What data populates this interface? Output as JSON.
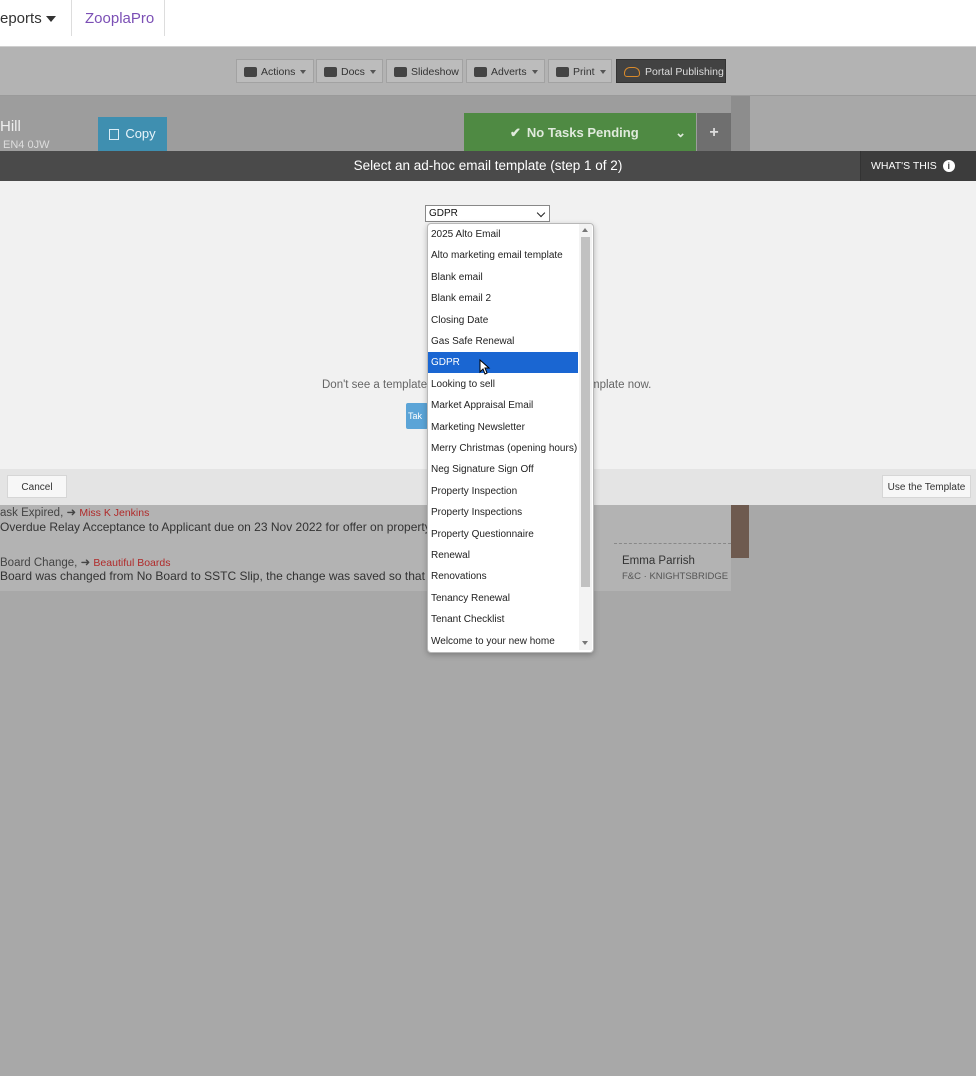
{
  "nav": {
    "reports_label": "eports",
    "zoopla_label": "ZooplaPro"
  },
  "toolbar": {
    "actions": "Actions",
    "docs": "Docs",
    "slideshow": "Slideshow",
    "adverts": "Adverts",
    "print": "Print",
    "portal_publishing": "Portal Publishing"
  },
  "property": {
    "name": "Hill",
    "postcode": "EN4 0JW",
    "copy_label": "Copy"
  },
  "tasks": {
    "label": "No Tasks Pending",
    "plus": "+"
  },
  "modal": {
    "title": "Select an ad-hoc email template (step 1 of 2)",
    "whats_this": "WHAT'S THIS",
    "help_left": "Don't see a template",
    "help_right": "mplate now.",
    "take_label": "Tak",
    "cancel": "Cancel",
    "use_template": "Use the Template"
  },
  "select": {
    "value": "GDPR",
    "selected_index": 6,
    "options": [
      "2025 Alto Email",
      "Alto marketing email template",
      "Blank email",
      "Blank email 2",
      "Closing Date",
      "Gas Safe Renewal",
      "GDPR",
      "Looking to sell",
      "Market Appraisal Email",
      "Marketing Newsletter",
      "Merry Christmas (opening hours)",
      "Neg Signature Sign Off",
      "Property Inspection",
      "Property Inspections",
      "Property Questionnaire",
      "Renewal",
      "Renovations",
      "Tenancy Renewal",
      "Tenant Checklist",
      "Welcome to your new home"
    ]
  },
  "activity": [
    {
      "title": "ask Expired,",
      "link": "Miss K Jenkins",
      "text": "Overdue Relay Acceptance to Applicant due on 23 Nov 2022 for offer on property 34"
    },
    {
      "title": "Board Change,",
      "link": "Beautiful Boards",
      "text": "Board was changed from No Board to SSTC Slip, the change was saved so that it cou"
    }
  ],
  "agent": {
    "name": "Emma Parrish",
    "office": "F&C · KNIGHTSBRIDGE"
  },
  "colors": {
    "selected": "#1a66d2",
    "tasks_green": "#4f8a43",
    "link_red": "#b02a2a",
    "zoopla_purple": "#7b4fb5"
  }
}
